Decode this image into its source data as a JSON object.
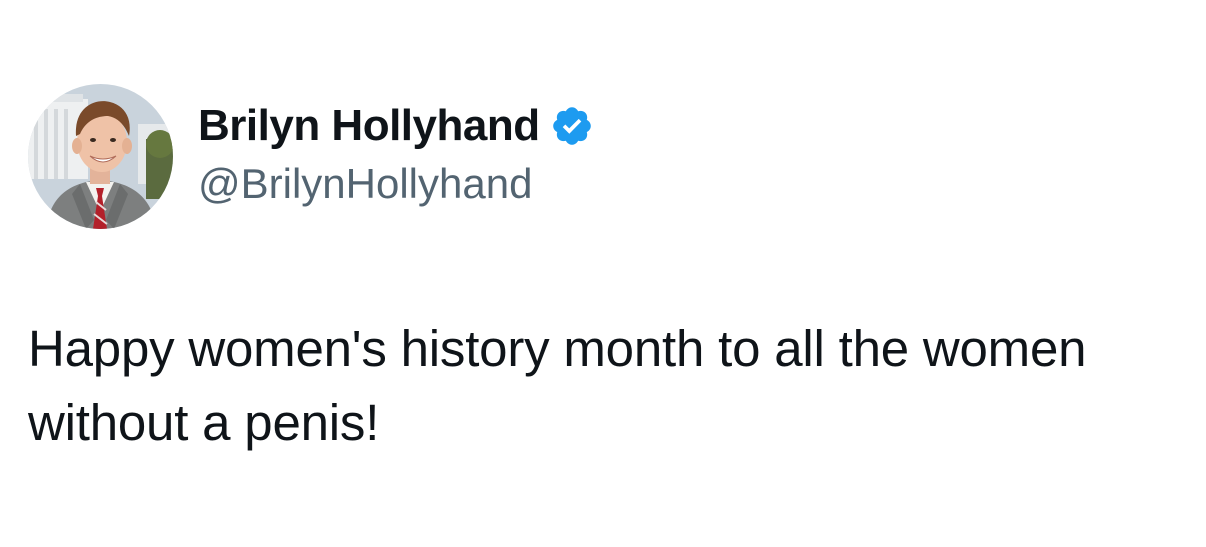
{
  "tweet": {
    "author": {
      "display_name": "Brilyn Hollyhand",
      "handle": "@BrilynHollyhand",
      "verified_icon": "verified-badge-icon",
      "verified_color": "#1d9bf0"
    },
    "text": "Happy women's history month to all the women without a penis!"
  }
}
